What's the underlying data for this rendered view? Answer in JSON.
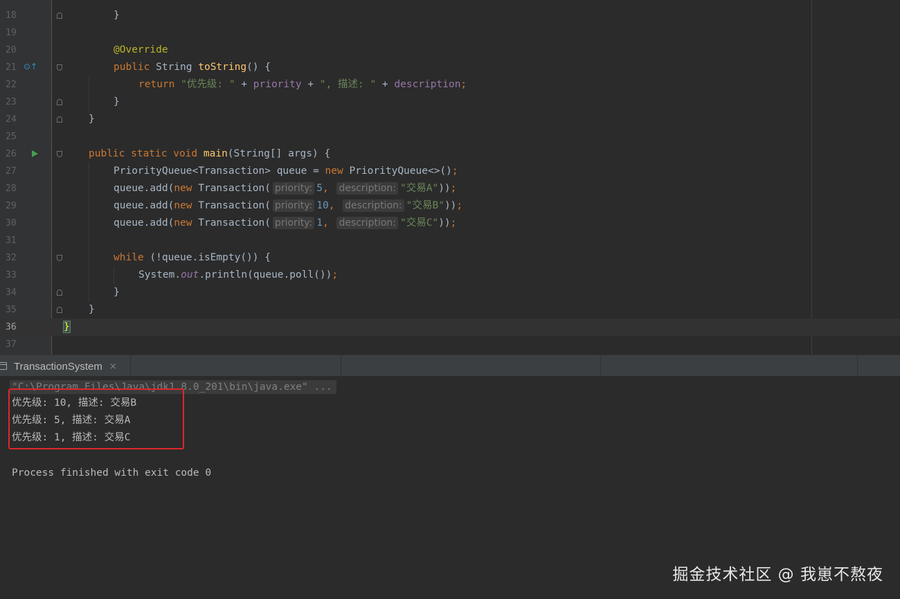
{
  "editor": {
    "line_numbers": [
      "18",
      "19",
      "20",
      "21",
      "22",
      "23",
      "24",
      "25",
      "26",
      "27",
      "28",
      "29",
      "30",
      "31",
      "32",
      "33",
      "34",
      "35",
      "36",
      "37"
    ],
    "current_line": "36",
    "code": {
      "l18": "}",
      "l20_annotation": "@Override",
      "l21_public": "public",
      "l21_type": " String ",
      "l21_name": "toString",
      "l21_rest": "() {",
      "l22_return": "return",
      "l22_str1": "\"优先级: \"",
      "l22_plus1": " + ",
      "l22_priority": "priority",
      "l22_plus2": " + ",
      "l22_str2": "\", 描述: \"",
      "l22_plus3": " + ",
      "l22_description": "description",
      "l22_semi": ";",
      "l23": "}",
      "l24": "}",
      "l26_kw": "public static void ",
      "l26_name": "main",
      "l26_rest": "(String[] args) {",
      "l27_a": "PriorityQueue<Transaction> queue = ",
      "l27_new": "new",
      "l27_b": " PriorityQueue<>()",
      "l27_semi": ";",
      "add_prefix": "queue.add(",
      "new_kw": "new",
      "transaction_ctor": " Transaction(",
      "hint_priority": "priority:",
      "hint_description": "description:",
      "comma": ",",
      "close_semi": "))",
      "semi": ";",
      "l28_priority": "5",
      "l28_desc": "\"交易A\"",
      "l29_priority": "10",
      "l29_desc": "\"交易B\"",
      "l30_priority": "1",
      "l30_desc": "\"交易C\"",
      "l32_while": "while",
      "l32_rest": " (!queue.isEmpty()) {",
      "l33_system": "System.",
      "l33_out": "out",
      "l33_rest": ".println(queue.poll())",
      "l33_semi": ";",
      "l34": "}",
      "l35": "}",
      "l36": "}"
    }
  },
  "run_panel": {
    "tab_label": "TransactionSystem",
    "tab_close": "×",
    "command": "\"C:\\Program Files\\Java\\jdk1.8.0_201\\bin\\java.exe\" ...",
    "output_lines": [
      "优先级: 10, 描述: 交易B",
      "优先级: 5, 描述: 交易A",
      "优先级: 1, 描述: 交易C"
    ],
    "exit_message": "Process finished with exit code 0"
  },
  "watermark": "掘金技术社区 @ 我崽不熬夜",
  "colors": {
    "background": "#2b2b2b",
    "keyword": "#cc7832",
    "string": "#6a8759",
    "number": "#6897bb",
    "field": "#9876aa",
    "method": "#ffc66d",
    "annotation": "#bbb529",
    "highlight_box": "#e0262b"
  },
  "icons": {
    "override": "override-arrow-icon",
    "run": "run-triangle-icon",
    "console": "console-icon"
  }
}
